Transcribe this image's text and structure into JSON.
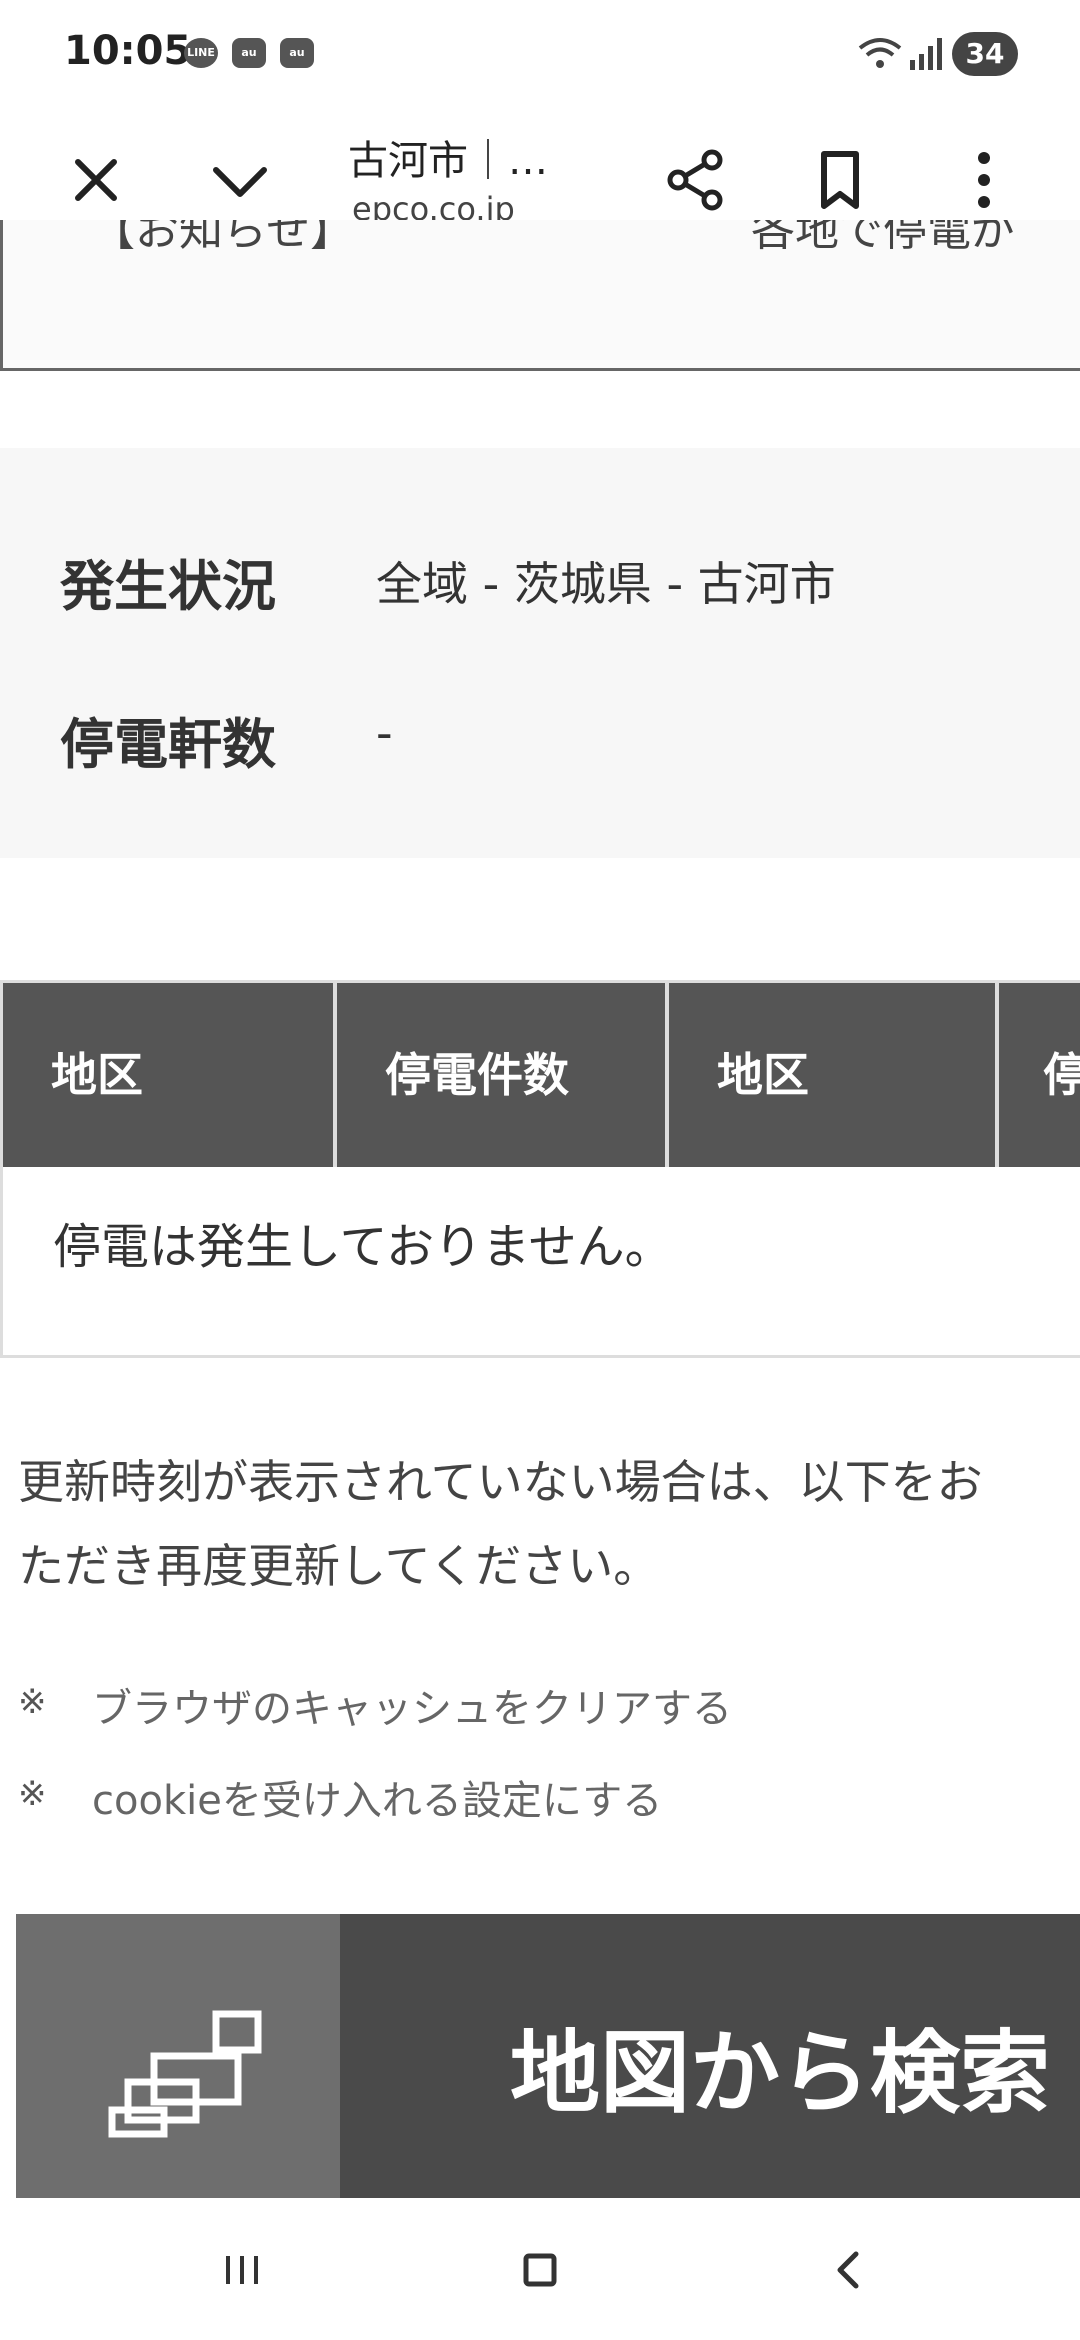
{
  "status_bar": {
    "time": "10:05",
    "notifications": [
      "LINE",
      "au",
      "au"
    ],
    "battery": "34"
  },
  "toolbar": {
    "title": "古河市｜…",
    "url": "epco.co.jp"
  },
  "notice": {
    "label": "【お知らせ】",
    "text": "各地で停電が"
  },
  "status_panel": {
    "occurrence_label": "発生状況",
    "occurrence_value": "全域 - 茨城県 - 古河市",
    "count_label": "停電軒数",
    "count_value": "-"
  },
  "table": {
    "headers": [
      "地区",
      "停電件数",
      "地区",
      "停"
    ],
    "empty_message": "停電は発生しておりません。"
  },
  "info": {
    "line1": "更新時刻が表示されていない場合は、以下をお",
    "line2": "ただき再度更新してください。",
    "note_mark": "※",
    "notes": [
      "ブラウザのキャッシュをクリアする",
      "cookieを受け入れる設定にする"
    ]
  },
  "map_search": {
    "label": "地図から検索"
  },
  "icons": [
    "close-icon",
    "chevron-down-icon",
    "share-icon",
    "bookmark-icon",
    "more-vert-icon",
    "map-icon",
    "recent-apps-icon",
    "home-icon",
    "back-icon"
  ],
  "colors": {
    "table_header": "#555555",
    "map_button": "#4a4a4a",
    "map_icon_bg": "#6e6e6e"
  }
}
